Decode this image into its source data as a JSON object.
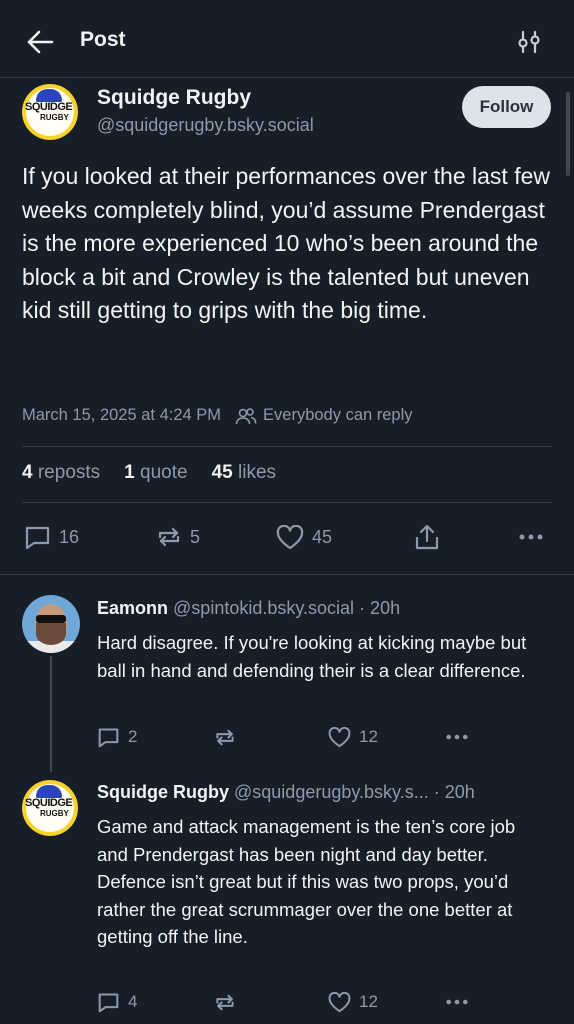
{
  "header": {
    "title": "Post"
  },
  "post": {
    "author_name": "Squidge Rugby",
    "author_handle": "@squidgerugby.bsky.social",
    "avatar_text": [
      "SQUIDGE",
      "RUGBY"
    ],
    "follow_label": "Follow",
    "text": "If you looked at their performances over the last few weeks completely blind, you’d assume Prendergast is the more experienced 10 who’s been around the block a bit and Crowley is the talented but uneven kid still getting to grips with the big time.",
    "timestamp": "March 15, 2025 at 4:24 PM",
    "reply_setting": "Everybody can reply",
    "stats": {
      "reposts_count": "4",
      "reposts_label": "reposts",
      "quotes_count": "1",
      "quotes_label": "quote",
      "likes_count": "45",
      "likes_label": "likes"
    },
    "actions": {
      "replies": "16",
      "reposts": "5",
      "likes": "45"
    }
  },
  "replies": [
    {
      "author_name": "Eamonn",
      "author_handle": "@spintokid.bsky.social",
      "age": "· 20h",
      "text": "Hard disagree. If you're looking at kicking maybe but ball in hand and defending their is a clear difference.",
      "replies": "2",
      "likes": "12"
    },
    {
      "author_name": "Squidge Rugby",
      "author_handle": "@squidgerugby.bsky.s...",
      "age": "· 20h",
      "text": "Game and attack management is the ten’s core job and Prendergast has been night and day better. Defence isn’t great but if this was two props, you’d rather the great scrummager over the one better at getting off the line.",
      "replies": "4",
      "likes": "12"
    }
  ],
  "colors": {
    "background": "#171e27",
    "muted": "#8c9aab",
    "divider": "#2e3947",
    "follow_bg": "#dde3ea"
  }
}
